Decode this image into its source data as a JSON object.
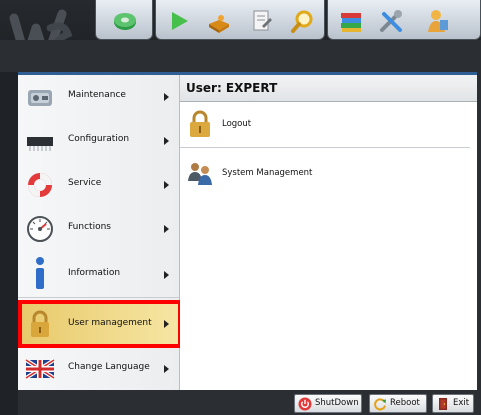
{
  "window": {
    "toolbar_icons": [
      "disc-icon",
      "play-icon",
      "puzzle-icon",
      "document-icon",
      "magnifier-icon",
      "books-icon",
      "tools-icon",
      "person-icon"
    ]
  },
  "menu": {
    "items": [
      {
        "label": "Maintenance",
        "icon": "maintenance-icon"
      },
      {
        "label": "Configuration",
        "icon": "chip-icon"
      },
      {
        "label": "Service",
        "icon": "lifebuoy-icon"
      },
      {
        "label": "Functions",
        "icon": "gauge-icon"
      },
      {
        "label": "Information",
        "icon": "info-icon"
      },
      {
        "label": "User management",
        "icon": "padlock-icon"
      },
      {
        "label": "Change Language",
        "icon": "uk-flag-icon"
      }
    ],
    "selected": "User management"
  },
  "content": {
    "title": "User: EXPERT",
    "items": [
      {
        "label": "Logout",
        "icon": "padlock-icon"
      },
      {
        "label": "System Management",
        "icon": "users-icon"
      }
    ]
  },
  "bottom": {
    "shutdown_label": "ShutDown",
    "reboot_label": "Reboot",
    "exit_label": "Exit"
  },
  "colors": {
    "highlight_border": "#ff0000",
    "accent_blue": "#2f5f93",
    "frame_dark": "#2b2f33"
  }
}
